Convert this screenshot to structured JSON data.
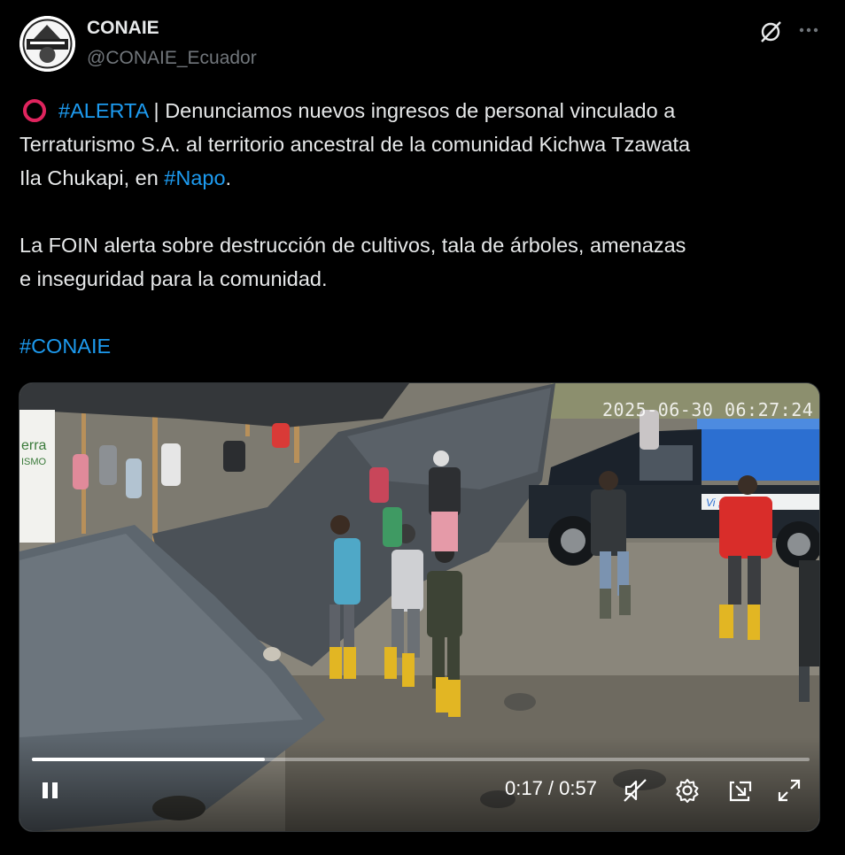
{
  "author": {
    "name": "CONAIE",
    "handle": "@CONAIE_Ecuador",
    "avatar_icon": "conaie-logo"
  },
  "header_actions": {
    "grok_icon": "grok-icon",
    "more_icon": "more-icon"
  },
  "tweet": {
    "line1_tag": "#ALERTA",
    "line1_rest": " | Denunciamos nuevos ingresos de personal vinculado a",
    "line2": "Terraturismo S.A. al territorio ancestral de la comunidad Kichwa Tzawata",
    "line3_start": "Ila Chukapi, en ",
    "line3_tag": "#Napo",
    "line3_end": ".",
    "para2_line1": "La FOIN alerta sobre destrucción de cultivos, tala de árboles, amenazas",
    "para2_line2": "e inseguridad para la comunidad.",
    "hashtag": "#CONAIE"
  },
  "video": {
    "timestamp_overlay": "2025-06-30 06:27:24",
    "current_time": "0:17",
    "duration": "0:57",
    "time_display": "0:17 / 0:57",
    "progress": 0.3,
    "truck_text": "Vi      ,sin dest",
    "banner_text": "erra ISMO"
  },
  "colors": {
    "background": "#000000",
    "text": "#e7e9ea",
    "secondary": "#71767b",
    "link": "#1d9bf0",
    "alert_circle": "#e0245e"
  }
}
